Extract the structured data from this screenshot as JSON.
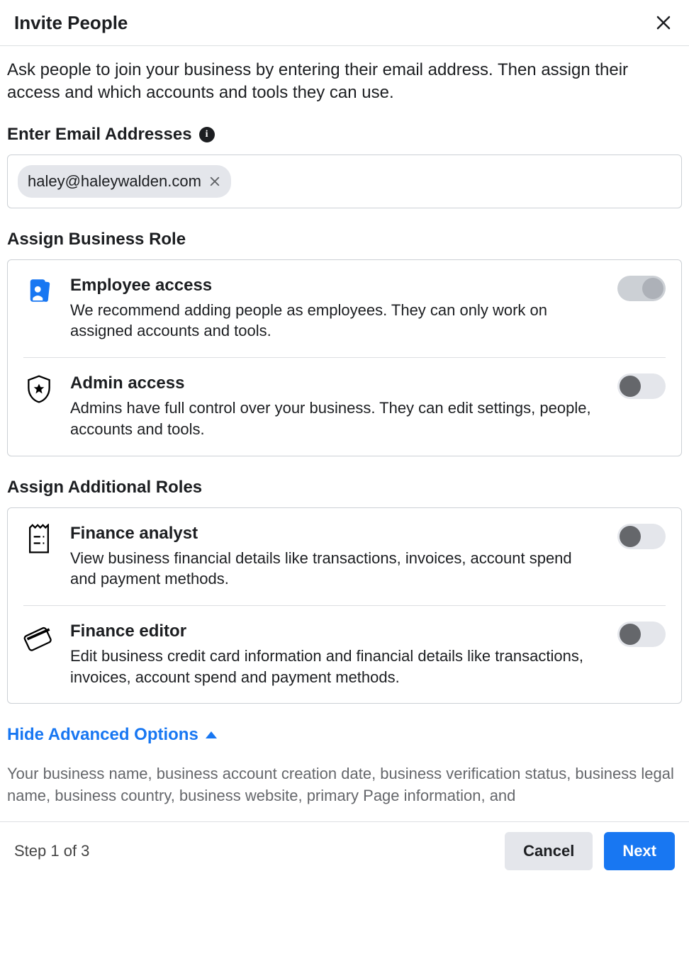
{
  "header": {
    "title": "Invite People"
  },
  "instruction": "Ask people to join your business by entering their email address. Then assign their access and which accounts and tools they can use.",
  "email_section": {
    "label": "Enter Email Addresses",
    "chips": [
      "haley@haleywalden.com"
    ]
  },
  "business_role_section": {
    "label": "Assign Business Role",
    "roles": [
      {
        "icon": "badge-icon",
        "title": "Employee access",
        "desc": "We recommend adding people as employees. They can only work on assigned accounts and tools.",
        "toggle_state": "on"
      },
      {
        "icon": "shield-icon",
        "title": "Admin access",
        "desc": "Admins have full control over your business. They can edit settings, people, accounts and tools.",
        "toggle_state": "off"
      }
    ]
  },
  "additional_role_section": {
    "label": "Assign Additional Roles",
    "roles": [
      {
        "icon": "receipt-icon",
        "title": "Finance analyst",
        "desc": "View business financial details like transactions, invoices, account spend and payment methods.",
        "toggle_state": "off"
      },
      {
        "icon": "card-icon",
        "title": "Finance editor",
        "desc": "Edit business credit card information and financial details like transactions, invoices, account spend and payment methods.",
        "toggle_state": "off"
      }
    ]
  },
  "advanced_toggle_label": "Hide Advanced Options",
  "disclosure_text": "Your business name, business account creation date, business verification status, business legal name, business country, business website, primary Page information, and",
  "footer": {
    "step": "Step 1 of 3",
    "cancel": "Cancel",
    "next": "Next"
  }
}
